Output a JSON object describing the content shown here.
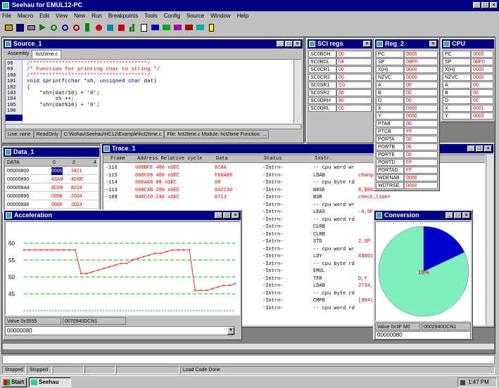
{
  "app": {
    "title": "Seehau for EMUL12-PC",
    "menu": [
      "File",
      "Macro",
      "Edit",
      "View",
      "New",
      "Run",
      "Breakpoints",
      "Tools",
      "Config",
      "Source",
      "Window",
      "Help"
    ]
  },
  "source": {
    "title": "Source_1",
    "tabs": [
      "Assembly",
      "hct2time.c"
    ],
    "line_numbers": [
      "98",
      "99",
      "100",
      "101",
      "102",
      "103",
      "104",
      "105",
      "106",
      "107"
    ],
    "lines": [
      "/*************************************/",
      "/* Function for printing char to string */",
      "/*************************************/",
      "void sprintf(char *sh, unsigned char dat)",
      "{",
      "    *sh=(dat/10) + '0';",
      "         sh ++;",
      "    *sh=(dat%10) + '0';"
    ],
    "status": [
      "Line: none",
      "ReadOnly",
      "C:\\Nohau\\Seehau\\HC12\\Example\\hct2time.c",
      "File: hct2time.c  Module: hct2time  Function: ..."
    ]
  },
  "sci": {
    "title": "SCI regs",
    "rows": [
      [
        "SC0BDH",
        "00"
      ],
      [
        "SC0BDL",
        "04"
      ],
      [
        "SC0CR1",
        "00"
      ],
      [
        "SC0CR2",
        "00"
      ],
      [
        "SC0SR1",
        "C0"
      ],
      [
        "SC0SR2",
        "00"
      ],
      [
        "SC0DRH",
        "80"
      ],
      [
        "SC0DRL",
        "00"
      ]
    ]
  },
  "reg": {
    "title": "Reg_2",
    "rows": [
      [
        "PC",
        "0005"
      ],
      [
        "SP",
        "0BF0"
      ],
      [
        "X(H)",
        "0000"
      ],
      [
        "NZVC",
        "0000"
      ],
      [
        "A",
        "00"
      ],
      [
        "B",
        "00"
      ],
      [
        "D",
        "00"
      ],
      [
        "X",
        "0000"
      ],
      [
        "Y",
        "0000"
      ],
      [
        "PTAB",
        "00"
      ],
      [
        "PTCB",
        "FF"
      ],
      [
        "PORTA",
        "00"
      ],
      [
        "PORTB",
        "00"
      ],
      [
        "PORTE",
        "00"
      ],
      [
        "PORTD",
        "FF"
      ],
      [
        "PORTAD",
        "FF"
      ],
      [
        "WDENAB",
        "0000"
      ],
      [
        "WDTRSE",
        "0000"
      ]
    ]
  },
  "cpu": {
    "title": "CPU",
    "rows": [
      [
        "PC",
        "0005"
      ],
      [
        "SP",
        "0BF0"
      ],
      [
        "X(H)",
        "0000"
      ],
      [
        "NZVC",
        "0000"
      ],
      [
        "A",
        "00"
      ],
      [
        "B",
        "00"
      ],
      [
        "D",
        "00"
      ],
      [
        "X",
        "0001"
      ],
      [
        "Y",
        "0002"
      ]
    ]
  },
  "data": {
    "title": "Data_1",
    "columns": [
      "DATA",
      "0",
      "2",
      "4"
    ],
    "rows": [
      [
        "00000800",
        "0000",
        "3421",
        ""
      ],
      [
        "00000890",
        "43A8",
        "4D6E",
        ""
      ],
      [
        "000008A4",
        "8D08",
        "8224",
        ""
      ],
      [
        "00000896",
        "0058",
        "2004",
        ""
      ],
      [
        "00000888",
        "0000",
        "2024",
        ""
      ]
    ]
  },
  "trace": {
    "title": "Trace_1",
    "columns": [
      "Frame",
      "Address Relative cycle",
      "Data",
      "Status",
      "Instr."
    ],
    "frames": [
      "-116",
      "-115",
      "-114",
      "-113",
      "-109",
      "",
      "",
      "",
      "",
      "",
      "",
      "",
      "",
      "",
      "",
      "",
      "",
      "",
      "",
      ""
    ],
    "addrs": [
      "000BFE 480 nSEC",
      "000C08 480 nSEC",
      "000AA8 08 nSEC",
      "000C4B 280 nSEC",
      "000C20 240 nSEC",
      "",
      "",
      "",
      "",
      "",
      "",
      "",
      "",
      "",
      "",
      "",
      "",
      "",
      "",
      ""
    ],
    "data": [
      "8C0A",
      "F60A88",
      "08",
      "042130",
      "0713",
      "",
      "",
      "",
      "",
      "",
      "",
      "",
      "",
      "",
      "",
      "",
      "",
      "",
      "",
      ""
    ],
    "status": [
      "-Intrn-",
      "-Intrn-",
      "-Intrn-",
      "-Intrn-",
      "-Intrn-",
      "-Intrn-",
      "-Intrn-",
      "-Intrn-",
      "-Intrn-",
      "-Intrn-",
      "-Intrn-",
      "-Intrn-",
      "-Intrn-",
      "-Intrn-",
      "-Intrn-",
      "-Intrn-",
      "-Intrn-",
      "-Intrn-",
      "-Intrn-",
      "-Intrn-"
    ],
    "instr": [
      "-- cpu word wr",
      "LDAB",
      "-- cpu byte rd",
      "BRSE",
      "BSR",
      "-- cpu word wr",
      "LEAS",
      "-- cpu word rd",
      "CLRB",
      "CLRB",
      "STD",
      "-- cpu word wr",
      "LDY",
      "-- cpu byte rd",
      "EMUL",
      "TFR",
      "LDAB",
      "-- cpu byte rd",
      "CMPB",
      "-- cpu word rd"
    ],
    "operand": [
      "",
      "change_hour_func",
      "",
      "8,$0080",
      "check_timer",
      "",
      "-4,SP",
      "",
      "",
      "",
      "2,SP",
      "",
      "#$801",
      "",
      "",
      "D,Y",
      "2734,",
      "",
      "[0841]",
      ""
    ]
  },
  "acc": {
    "title": "Acceleration",
    "yticks": [
      "60",
      "55",
      "50",
      "45"
    ],
    "value_label": "Value 0x3555",
    "value2": "0070940DCN1",
    "input": "00000080"
  },
  "conv": {
    "title": "Conversion",
    "slice_label": "18%",
    "value_label": "Value 0x3F M0",
    "value2": "0002940DCN1",
    "input": "00000080"
  },
  "chart_data": [
    {
      "type": "line",
      "title": "Acceleration",
      "ylim": [
        40,
        65
      ],
      "yticks": [
        60,
        55,
        50,
        45
      ],
      "values": [
        58,
        58,
        58,
        58,
        58,
        58,
        58,
        58,
        58,
        58,
        51,
        51,
        51.5,
        52,
        52.5,
        53,
        53.5,
        54,
        54,
        55,
        55.5,
        56,
        56.5,
        57,
        57,
        57.5,
        58,
        58,
        58,
        58,
        46,
        46,
        46,
        46.5,
        47,
        47.5,
        47.5,
        48
      ]
    },
    {
      "type": "pie",
      "title": "Conversion",
      "slices": [
        {
          "label": "",
          "value": 82,
          "color": "#7fefbf"
        },
        {
          "label": "18%",
          "value": 18,
          "color": "#0000cc"
        }
      ]
    }
  ],
  "statusbar": [
    "Stopped",
    "Stopped",
    "",
    "",
    "",
    "Load Code Done"
  ],
  "taskbar": {
    "start": "Start",
    "app": "Seehau",
    "time": "1:47 PM"
  }
}
